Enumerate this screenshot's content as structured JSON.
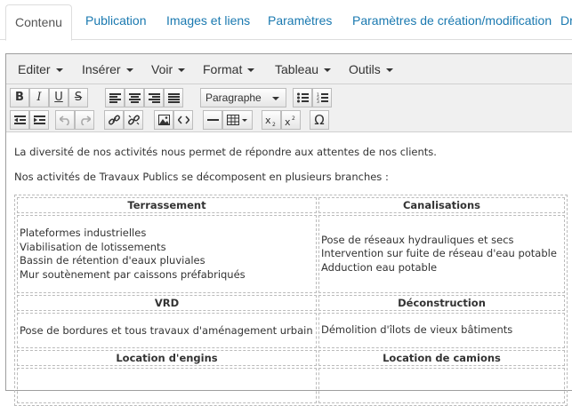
{
  "tabs": [
    {
      "label": "Contenu",
      "active": true
    },
    {
      "label": "Publication"
    },
    {
      "label": "Images et liens"
    },
    {
      "label": "Paramètres"
    },
    {
      "label": "Paramètres de création/modification"
    },
    {
      "label": "Dr"
    }
  ],
  "menubar": [
    "Editer",
    "Insérer",
    "Voir",
    "Format",
    "Tableau",
    "Outils"
  ],
  "toolbar": {
    "format_select": "Paragraphe",
    "row1_icons": [
      "bold-icon",
      "italic-icon",
      "underline-icon",
      "strikethrough-icon",
      "align-left-icon",
      "align-center-icon",
      "align-right-icon",
      "align-justify-icon",
      "bullet-list-icon",
      "numbered-list-icon"
    ],
    "row2_icons": [
      "outdent-icon",
      "indent-icon",
      "undo-icon",
      "redo-icon",
      "link-icon",
      "unlink-icon",
      "image-icon",
      "code-icon",
      "horizontal-rule-icon",
      "table-icon",
      "subscript-icon",
      "superscript-icon",
      "special-char-icon"
    ],
    "glyphs": {
      "bold": "B",
      "italic": "I",
      "underline": "U",
      "strike": "S",
      "omega": "Ω"
    }
  },
  "content": {
    "paragraph1": "La diversité de nos activités nous permet de répondre aux attentes de nos clients.",
    "paragraph2": "Nos activités de Travaux Publics se décomposent en plusieurs branches :",
    "table": [
      {
        "headers": [
          "Terrassement",
          "Canalisations"
        ],
        "cells": [
          [
            "Plateformes industrielles",
            "Viabilisation de lotissements",
            "Bassin de rétention d'eaux pluviales",
            "Mur soutènement par caissons préfabriqués"
          ],
          [
            "Pose de réseaux hydrauliques et secs",
            "Intervention sur fuite de réseau d'eau potable",
            "Adduction eau potable"
          ]
        ]
      },
      {
        "headers": [
          "VRD",
          "Déconstruction"
        ],
        "cells": [
          [
            "Pose de bordures et tous travaux d'aménagement urbain"
          ],
          [
            "Démolition d'îlots de vieux bâtiments"
          ]
        ]
      },
      {
        "headers": [
          "Location d'engins",
          "Location de camions"
        ],
        "cells": [
          [],
          []
        ]
      }
    ]
  }
}
